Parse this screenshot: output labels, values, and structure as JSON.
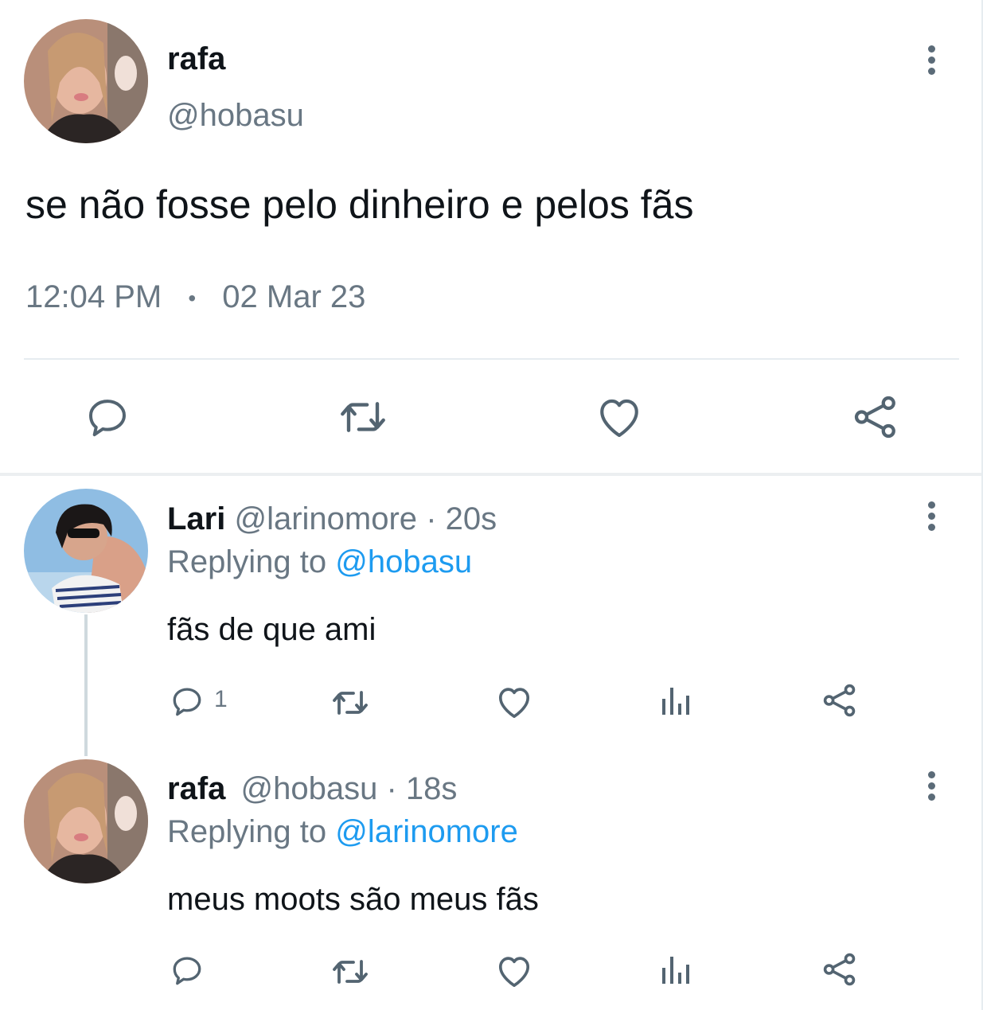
{
  "main_tweet": {
    "display_name": "rafa",
    "handle": "@hobasu",
    "text": "se não fosse pelo dinheiro e pelos fãs",
    "time": "12:04 PM",
    "separator": "•",
    "date": "02 Mar 23"
  },
  "replies": [
    {
      "display_name": "Lari",
      "handle": "@larinomore",
      "age": "· 20s",
      "replying_prefix": "Replying to",
      "replying_to": "@hobasu",
      "text": "fãs de que ami",
      "reply_count": "1"
    },
    {
      "display_name": "rafa",
      "handle": "@hobasu",
      "age": "· 18s",
      "replying_prefix": "Replying to",
      "replying_to": "@larinomore",
      "text": "meus moots são meus fãs"
    }
  ],
  "icons": {
    "action": [
      "reply-icon",
      "retweet-icon",
      "like-icon",
      "share-icon"
    ],
    "reply_actions": [
      "reply-icon",
      "retweet-icon",
      "like-icon",
      "views-icon",
      "share-icon"
    ],
    "menu": "more-options-icon"
  },
  "colors": {
    "text": "#0f1419",
    "muted": "#697783",
    "link": "#1d9bf0",
    "icon": "#536471"
  }
}
